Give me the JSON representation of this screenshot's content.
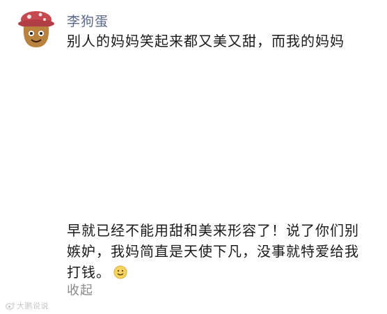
{
  "post": {
    "username": "李狗蛋",
    "first_line": "别人的妈妈笑起来都又美又甜，而我的妈妈",
    "body_lines": [
      "早就已经不能用甜和美来形容了！说了你们别",
      "嫉妒，我妈简直是天使下凡，没事就特爱给我",
      "打钱。"
    ],
    "emoji": "smile-emoji",
    "collapse_label": "收起"
  },
  "watermark": {
    "icon": "weibo-logo-icon",
    "text": "大鹏说说"
  },
  "colors": {
    "username": "#5b6b8c",
    "body_text": "#1a1a1a",
    "collapse": "#8a8a8a",
    "avatar_hat": "#c6494f",
    "avatar_face": "#b9823f"
  }
}
